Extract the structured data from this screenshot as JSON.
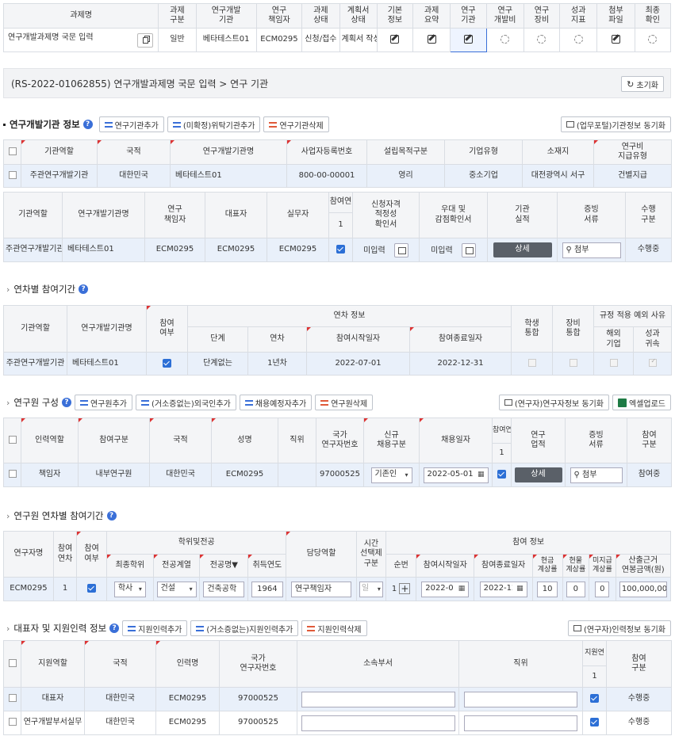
{
  "top_table": {
    "headers": [
      "과제명",
      "과제\n구분",
      "연구개발\n기관",
      "연구\n책임자",
      "과제\n상태",
      "계획서\n상태",
      "기본\n정보",
      "과제\n요약",
      "연구\n기관",
      "연구\n개발비",
      "연구\n장비",
      "성과\n지표",
      "첨부\n파일",
      "최종\n확인"
    ],
    "row": {
      "name": "연구개발과제명 국문 입력",
      "type": "일반",
      "org": "베타테스트01",
      "lead": "ECM0295",
      "status": "신청/접수",
      "plan_status": "계획서 작성"
    }
  },
  "title_bar": {
    "text": "(RS-2022-01062855) 연구개발과제명 국문 입력 > 연구 기관",
    "reset": "초기화"
  },
  "org_section": {
    "title": "연구개발기관 정보",
    "btn_add": "연구기관추가",
    "btn_consign": "(미확정)위탁기관추가",
    "btn_delete": "연구기관삭제",
    "btn_sync": "(업무포털)기관정보 동기화",
    "headers": [
      "기관역할",
      "국적",
      "연구개발기관명",
      "사업자등록번호",
      "설립목적구분",
      "기업유형",
      "소재지",
      "연구비\n지급유형"
    ],
    "row": {
      "role": "주관연구개발기관",
      "nation": "대한민국",
      "name": "베타테스트01",
      "bizno": "800-00-00001",
      "purpose": "영리",
      "ctype": "중소기업",
      "loc": "대전광역시 서구",
      "paytype": "건별지급"
    }
  },
  "org_table2": {
    "headers": [
      "기관역할",
      "연구개발기관명",
      "연구\n책임자",
      "대표자",
      "실무자",
      "참여연",
      "신청자격\n적정성\n확인서",
      "우대 및\n감점확인서",
      "기관\n실적",
      "증빙\n서류",
      "수행\n구분"
    ],
    "part_num": "1",
    "row": {
      "role": "주관연구개발기관",
      "name": "베타테스트01",
      "lead": "ECM0295",
      "rep": "ECM0295",
      "staff": "ECM0295",
      "q1": "미입력",
      "q2": "미입력",
      "detail": "상세",
      "attach": "첨부",
      "status": "수행중"
    }
  },
  "year_section": {
    "title": "연차별 참여기간",
    "headers": {
      "role": "기관역할",
      "name": "연구개발기관명",
      "part": "참여\n여부",
      "yearinfo": "연차 정보",
      "stage": "단계",
      "year": "연차",
      "start": "참여시작일자",
      "end": "참여종료일자",
      "student": "학생\n통합",
      "equip": "장비\n통합",
      "rule": "규정 적용 예외 사유",
      "overseas": "해외\n기업",
      "result": "성과\n귀속"
    },
    "row": {
      "role": "주관연구개발기관",
      "name": "베타테스트01",
      "stage": "단계없는",
      "year": "1년차",
      "start": "2022-07-01",
      "end": "2022-12-31"
    }
  },
  "res_section": {
    "title": "연구원 구성",
    "btn_add": "연구원추가",
    "btn_foreign": "(거소증없는)외국인추가",
    "btn_plan": "채용예정자추가",
    "btn_delete": "연구원삭제",
    "btn_sync": "(연구자)연구자정보 동기화",
    "btn_excel": "엑셀업로드",
    "headers": [
      "인력역할",
      "참여구분",
      "국적",
      "성명",
      "직위",
      "국가\n연구자번호",
      "신규\n채용구분",
      "채용일자",
      "참여연",
      "연구\n업적",
      "증빙\n서류",
      "참여\n구분"
    ],
    "part_num": "1",
    "row": {
      "role": "책임자",
      "ptype": "내부연구원",
      "nation": "대한민국",
      "name": "ECM0295",
      "no": "97000525",
      "hire": "기존인",
      "date": "2022-05-01",
      "detail": "상세",
      "attach": "첨부",
      "status": "참여중"
    }
  },
  "res_year": {
    "title": "연구원 연차별 참여기간",
    "headers": {
      "name": "연구자명",
      "year": "참여\n연차",
      "part": "참여\n여부",
      "degree": "학위및전공",
      "deg": "최종학위",
      "field": "전공계열",
      "major": "전공명▼",
      "gradyear": "취득연도",
      "duty": "담당역할",
      "time": "시간\n선택제\n구분",
      "info": "참여 정보",
      "seq": "순번",
      "start": "참여시작일자",
      "end": "참여종료일자",
      "cash": "현금\n계상률",
      "inkind": "현물\n계상률",
      "unpaid": "미지급\n계상률",
      "salary": "산출근거\n연봉금액(원)"
    },
    "row": {
      "name": "ECM0295",
      "year": "1",
      "deg": "학사",
      "field": "건설",
      "major": "건축공학",
      "gradyear": "1964",
      "duty": "연구책임자",
      "time": "일",
      "seq": "1",
      "start": "2022-07-01",
      "end": "2022-12-31",
      "cash": "10",
      "inkind": "0",
      "unpaid": "0",
      "salary": "100,000,000"
    }
  },
  "support": {
    "title": "대표자 및 지원인력 정보",
    "btn_add": "지원인력추가",
    "btn_foreign": "(거소증없는)지원인력추가",
    "btn_delete": "지원인력삭제",
    "btn_sync": "(연구자)인력정보 동기화",
    "headers": [
      "지원역할",
      "국적",
      "인력명",
      "국가\n연구자번호",
      "소속부서",
      "직위",
      "지원연",
      "참여\n구분"
    ],
    "part_num": "1",
    "rows": [
      {
        "role": "대표자",
        "nation": "대한민국",
        "name": "ECM0295",
        "no": "97000525",
        "status": "수행중"
      },
      {
        "role": "연구개발부서실무",
        "nation": "대한민국",
        "name": "ECM0295",
        "no": "97000525",
        "status": "수행중"
      }
    ]
  }
}
